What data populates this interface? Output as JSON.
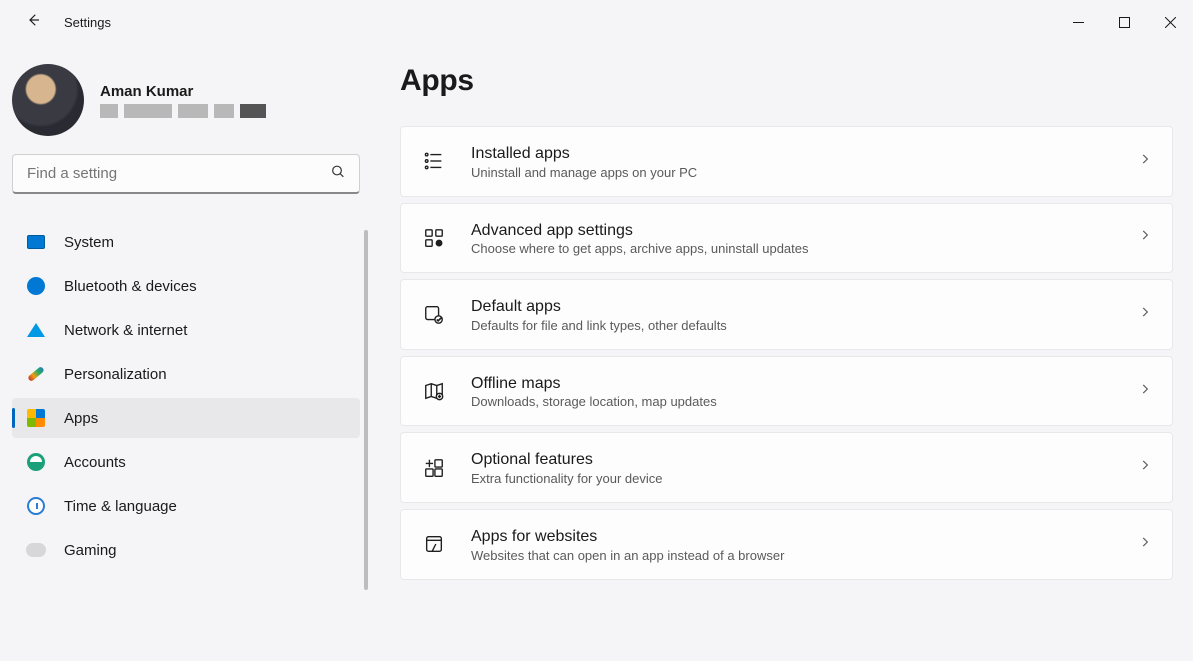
{
  "window": {
    "title": "Settings"
  },
  "user": {
    "name": "Aman Kumar"
  },
  "search": {
    "placeholder": "Find a setting"
  },
  "nav": {
    "items": [
      {
        "label": "System"
      },
      {
        "label": "Bluetooth & devices"
      },
      {
        "label": "Network & internet"
      },
      {
        "label": "Personalization"
      },
      {
        "label": "Apps"
      },
      {
        "label": "Accounts"
      },
      {
        "label": "Time & language"
      },
      {
        "label": "Gaming"
      }
    ],
    "active_index": 4
  },
  "page": {
    "heading": "Apps",
    "cards": [
      {
        "title": "Installed apps",
        "sub": "Uninstall and manage apps on your PC"
      },
      {
        "title": "Advanced app settings",
        "sub": "Choose where to get apps, archive apps, uninstall updates"
      },
      {
        "title": "Default apps",
        "sub": "Defaults for file and link types, other defaults"
      },
      {
        "title": "Offline maps",
        "sub": "Downloads, storage location, map updates"
      },
      {
        "title": "Optional features",
        "sub": "Extra functionality for your device"
      },
      {
        "title": "Apps for websites",
        "sub": "Websites that can open in an app instead of a browser"
      }
    ]
  }
}
